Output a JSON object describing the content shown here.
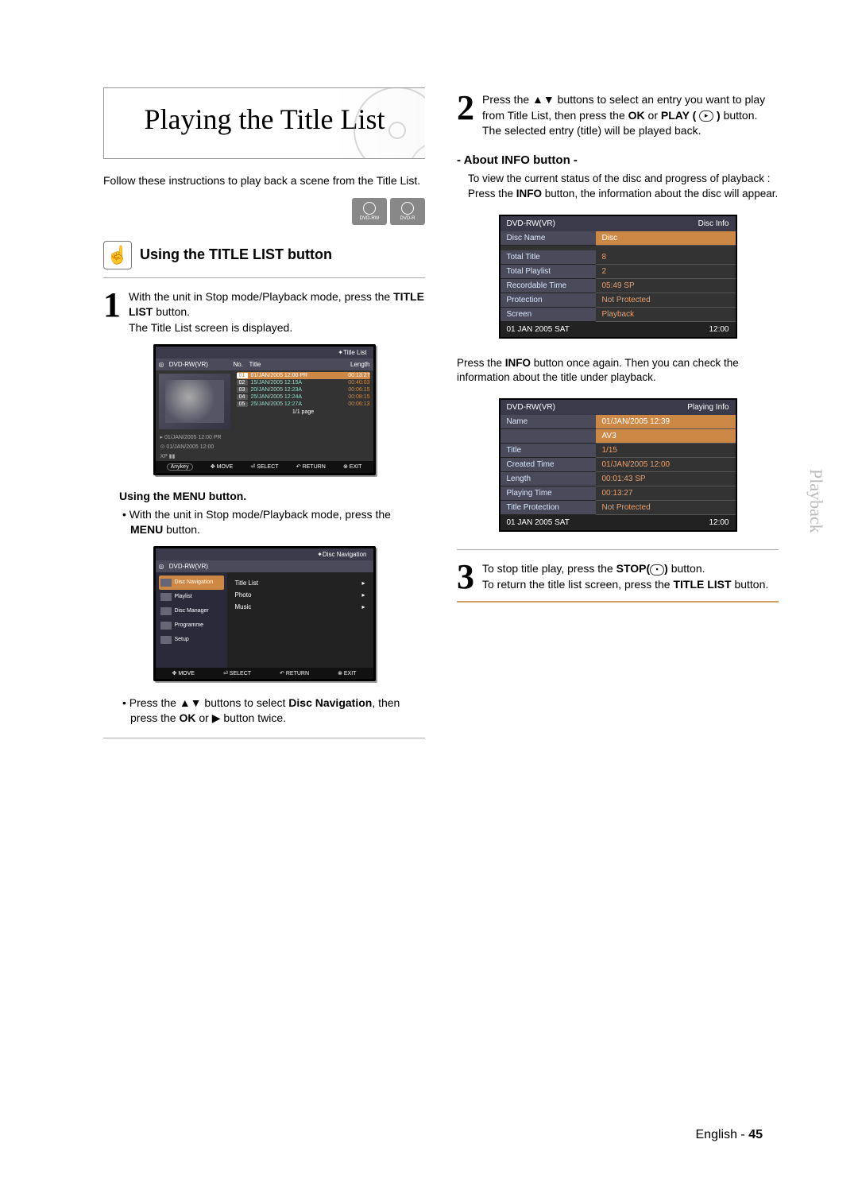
{
  "page": {
    "language": "English",
    "number": "45",
    "side_tab": "Playback"
  },
  "title_block": {
    "heading": "Playing the Title List"
  },
  "intro": "Follow these instructions to play back a scene from the Title List.",
  "disc_badges": [
    "DVD-RW",
    "DVD-R"
  ],
  "section1": {
    "heading": "Using the TITLE LIST button",
    "step1_a": "With the unit in Stop mode/Playback mode, press the ",
    "step1_b": "TITLE LIST",
    "step1_c": " button.",
    "step1_d": "The Title List screen is displayed."
  },
  "osd_titlelist": {
    "window": "Title List",
    "source": "DVD-RW(VR)",
    "cols": {
      "no": "No.",
      "title": "Title",
      "length": "Length"
    },
    "rows": [
      {
        "n": "01",
        "t": "01/JAN/2005 12:00 PR",
        "l": "00:13:27"
      },
      {
        "n": "02",
        "t": "15/JAN/2005 12:15A",
        "l": "00:40:03"
      },
      {
        "n": "03",
        "t": "20/JAN/2005 12:23A",
        "l": "00:06:15"
      },
      {
        "n": "04",
        "t": "25/JAN/2005 12:24A",
        "l": "00:08:15"
      },
      {
        "n": "05",
        "t": "25/JAN/2005 12:27A",
        "l": "00:06:13"
      }
    ],
    "meta1": "01/JAN/2005 12:00 PR",
    "meta2": "01/JAN/2005 12:00",
    "xp": "XP",
    "page": "1/1 page",
    "foot": {
      "move": "MOVE",
      "select": "SELECT",
      "ret": "RETURN",
      "exit": "EXIT",
      "anykey": "Anykey"
    }
  },
  "menu_section": {
    "heading": "Using the MENU button.",
    "bullet1_a": "With the unit in Stop mode/Playback mode, press the ",
    "bullet1_b": "MENU",
    "bullet1_c": " button."
  },
  "osd_nav": {
    "window": "Disc Navigation",
    "source": "DVD-RW(VR)",
    "left": [
      "Disc Navigation",
      "Playlist",
      "Disc Manager",
      "Programme",
      "Setup"
    ],
    "right": [
      "Title List",
      "Photo",
      "Music"
    ],
    "foot": {
      "move": "MOVE",
      "select": "SELECT",
      "ret": "RETURN",
      "exit": "EXIT"
    }
  },
  "menu_bullet2_a": "Press the ",
  "menu_bullet2_b": " buttons to select ",
  "menu_bullet2_c": "Disc Navigation",
  "menu_bullet2_d": ", then press the ",
  "menu_bullet2_e": "OK",
  "menu_bullet2_f": " or ",
  "menu_bullet2_g": " button twice.",
  "step2": {
    "a": "Press the ",
    "b": " buttons to select an entry you want to play from Title List, then press the ",
    "c": "OK",
    "d": " or ",
    "e": "PLAY ( ",
    "f": " )",
    "g": " button.",
    "h": "The selected entry (title) will be played back."
  },
  "about_info": {
    "heading": "- About INFO button -",
    "body_a": "To view the current status of the disc and progress of playback : Press the ",
    "body_b": "INFO",
    "body_c": " button, the information about the disc will appear."
  },
  "disc_info_panel": {
    "top_l": "DVD-RW(VR)",
    "top_r": "Disc Info",
    "rows": [
      {
        "k": "Disc Name",
        "v": "Disc",
        "sel": true
      },
      {
        "k": "Total Title",
        "v": "8"
      },
      {
        "k": "Total Playlist",
        "v": "2"
      },
      {
        "k": "Recordable Time",
        "v": "05:49  SP"
      },
      {
        "k": "Protection",
        "v": "Not Protected"
      },
      {
        "k": "Screen",
        "v": "Playback"
      }
    ],
    "foot_l": "01 JAN 2005 SAT",
    "foot_r": "12:00"
  },
  "info_again_a": "Press the ",
  "info_again_b": "INFO",
  "info_again_c": " button once again. Then you can check the information about the title under playback.",
  "playing_info_panel": {
    "top_l": "DVD-RW(VR)",
    "top_r": "Playing Info",
    "rows": [
      {
        "k": "Name",
        "v": "01/JAN/2005 12:39"
      },
      {
        "k": "",
        "v": "AV3"
      },
      {
        "k": "Title",
        "v": "1/15"
      },
      {
        "k": "Created Time",
        "v": "01/JAN/2005 12:00"
      },
      {
        "k": "Length",
        "v": "00:01:43 SP"
      },
      {
        "k": "Playing Time",
        "v": "00:13:27"
      },
      {
        "k": "Title Protection",
        "v": "Not Protected"
      }
    ],
    "foot_l": "01 JAN 2005 SAT",
    "foot_r": "12:00"
  },
  "step3": {
    "a": "To stop title play, press the ",
    "b": "STOP(",
    "c": ")",
    "d": " button.",
    "e": "To return the title list screen, press the ",
    "f": "TITLE LIST",
    "g": " button."
  }
}
